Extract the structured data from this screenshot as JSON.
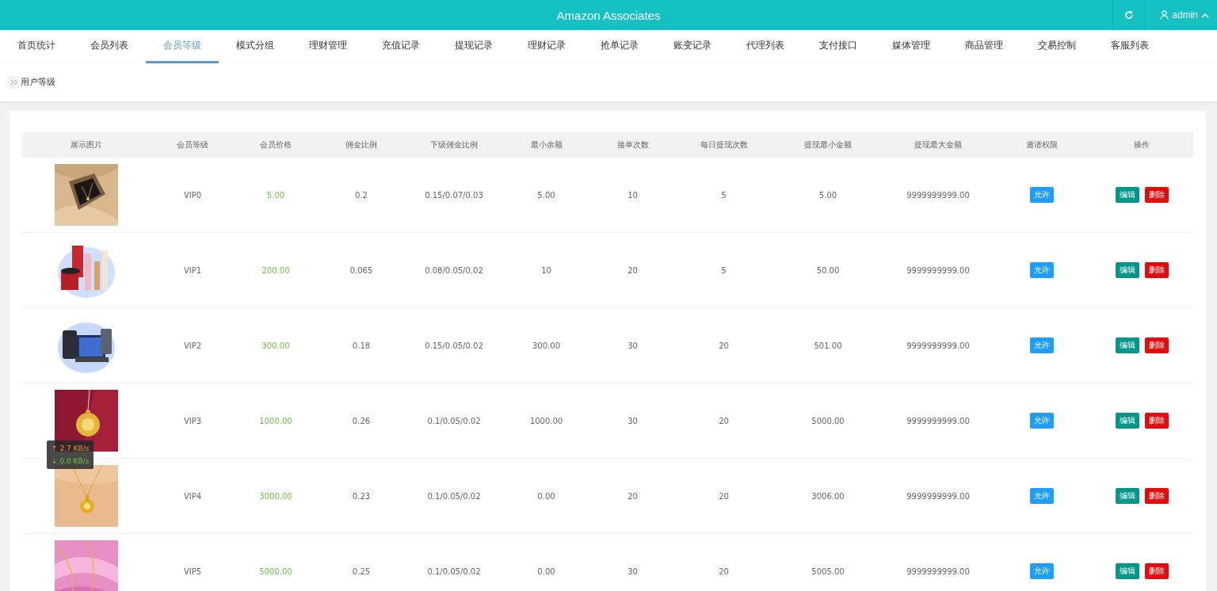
{
  "header": {
    "title": "Amazon Associates",
    "user": "admin"
  },
  "tabs": [
    {
      "label": "首页统计",
      "selected": false
    },
    {
      "label": "会员列表",
      "selected": false
    },
    {
      "label": "会员等级",
      "selected": true
    },
    {
      "label": "模式分组",
      "selected": false
    },
    {
      "label": "理财管理",
      "selected": false
    },
    {
      "label": "充值记录",
      "selected": false
    },
    {
      "label": "提现记录",
      "selected": false
    },
    {
      "label": "理财记录",
      "selected": false
    },
    {
      "label": "抢单记录",
      "selected": false
    },
    {
      "label": "账变记录",
      "selected": false
    },
    {
      "label": "代理列表",
      "selected": false
    },
    {
      "label": "支付接口",
      "selected": false
    },
    {
      "label": "媒体管理",
      "selected": false
    },
    {
      "label": "商品管理",
      "selected": false
    },
    {
      "label": "交易控制",
      "selected": false
    },
    {
      "label": "客服列表",
      "selected": false
    }
  ],
  "breadcrumb": "用户等级",
  "table": {
    "columns": [
      "展示图片",
      "会员等级",
      "会员价格",
      "佣金比例",
      "下级佣金比例",
      "最小余额",
      "接单次数",
      "每日提现次数",
      "提现最小金额",
      "提现最大金额",
      "邀请权限",
      "操作"
    ],
    "rows": [
      {
        "level": "VIP0",
        "price": "5.00",
        "commission": "0.2",
        "sub_commission": "0.15/0.07/0.03",
        "min_balance": "5.00",
        "orders": "10",
        "daily_withdrawals": "5",
        "min_withdraw": "5.00",
        "max_withdraw": "9999999999.00",
        "invite": "允许",
        "actions": [
          "编辑",
          "删除"
        ]
      },
      {
        "level": "VIP1",
        "price": "200.00",
        "commission": "0.065",
        "sub_commission": "0.08/0.05/0.02",
        "min_balance": "10",
        "orders": "20",
        "daily_withdrawals": "5",
        "min_withdraw": "50.00",
        "max_withdraw": "9999999999.00",
        "invite": "允许",
        "actions": [
          "编辑",
          "删除"
        ]
      },
      {
        "level": "VIP2",
        "price": "300.00",
        "commission": "0.18",
        "sub_commission": "0.15/0.05/0.02",
        "min_balance": "300.00",
        "orders": "30",
        "daily_withdrawals": "20",
        "min_withdraw": "501.00",
        "max_withdraw": "9999999999.00",
        "invite": "允许",
        "actions": [
          "编辑",
          "删除"
        ]
      },
      {
        "level": "VIP3",
        "price": "1000.00",
        "commission": "0.26",
        "sub_commission": "0.1/0.05/0.02",
        "min_balance": "1000.00",
        "orders": "30",
        "daily_withdrawals": "20",
        "min_withdraw": "5000.00",
        "max_withdraw": "9999999999.00",
        "invite": "允许",
        "actions": [
          "编辑",
          "删除"
        ]
      },
      {
        "level": "VIP4",
        "price": "3000.00",
        "commission": "0.23",
        "sub_commission": "0.1/0.05/0.02",
        "min_balance": "0.00",
        "orders": "20",
        "daily_withdrawals": "20",
        "min_withdraw": "3006.00",
        "max_withdraw": "9999999999.00",
        "invite": "允许",
        "actions": [
          "编辑",
          "删除"
        ]
      },
      {
        "level": "VIP5",
        "price": "5000.00",
        "commission": "0.25",
        "sub_commission": "0.1/0.05/0.02",
        "min_balance": "0.00",
        "orders": "30",
        "daily_withdrawals": "20",
        "min_withdraw": "5005.00",
        "max_withdraw": "9999999999.00",
        "invite": "允许",
        "actions": [
          "编辑",
          "删除"
        ]
      }
    ]
  },
  "net_speed": {
    "upload": "↑ 2.7 KB/s",
    "download": "↓ 0.0 KB/s"
  }
}
